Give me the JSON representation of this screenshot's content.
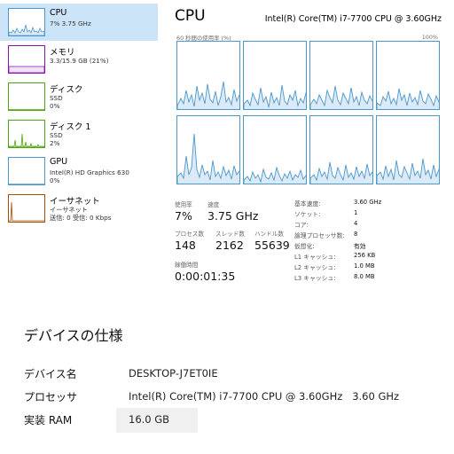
{
  "sidebar": {
    "items": [
      {
        "name": "CPU",
        "sub1": "7% 3.75 GHz",
        "sub2": "",
        "color": "#4c98cc"
      },
      {
        "name": "メモリ",
        "sub1": "3.3/15.9 GB (21%)",
        "sub2": "",
        "color": "#8b12ae"
      },
      {
        "name": "ディスク",
        "sub1": "SSD",
        "sub2": "0%",
        "color": "#4da60c"
      },
      {
        "name": "ディスク 1",
        "sub1": "SSD",
        "sub2": "2%",
        "color": "#4da60c"
      },
      {
        "name": "GPU",
        "sub1": "Intel(R) HD Graphics 630",
        "sub2": "0%",
        "color": "#4c98cc"
      },
      {
        "name": "イーサネット",
        "sub1": "イーサネット",
        "sub2": "送信: 0 受信: 0 Kbps",
        "color": "#a74f01"
      }
    ]
  },
  "detail": {
    "title": "CPU",
    "model": "Intel(R) Core(TM) i7-7700 CPU @ 3.60GHz",
    "graph_caption": "60 秒間の使用率 (%)",
    "graph_max": "100%",
    "stats": {
      "usage_label": "使用率",
      "usage_value": "7%",
      "speed_label": "速度",
      "speed_value": "3.75 GHz",
      "processes_label": "プロセス数",
      "processes_value": "148",
      "threads_label": "スレッド数",
      "threads_value": "2162",
      "handles_label": "ハンドル数",
      "handles_value": "55639",
      "uptime_label": "稼働時間",
      "uptime_value": "0:00:01:35"
    },
    "specs": [
      {
        "label": "基本速度:",
        "value": "3.60 GHz"
      },
      {
        "label": "ソケット:",
        "value": "1"
      },
      {
        "label": "コア:",
        "value": "4"
      },
      {
        "label": "論理プロセッサ数:",
        "value": "8"
      },
      {
        "label": "仮想化:",
        "value": "有効"
      },
      {
        "label": "L1 キャッシュ:",
        "value": "256 KB"
      },
      {
        "label": "L2 キャッシュ:",
        "value": "1.0 MB"
      },
      {
        "label": "L3 キャッシュ:",
        "value": "8.0 MB"
      }
    ],
    "accent_color": "#4c98cc"
  },
  "device_spec": {
    "heading": "デバイスの仕様",
    "rows": [
      {
        "label": "デバイス名",
        "value": "DESKTOP-J7ET0IE"
      },
      {
        "label": "プロセッサ",
        "value": "Intel(R) Core(TM) i7-7700 CPU @ 3.60GHz   3.60 GHz"
      },
      {
        "label": "実装 RAM",
        "value": "16.0 GB"
      }
    ]
  }
}
